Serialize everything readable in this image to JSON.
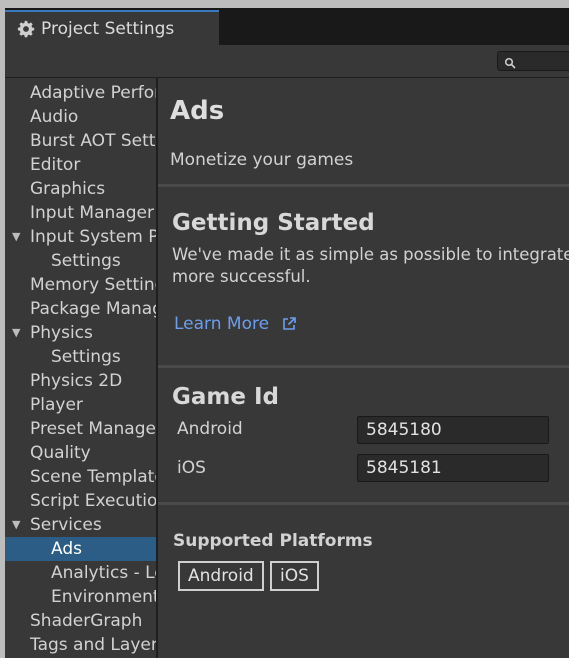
{
  "window": {
    "tab_title": "Project Settings"
  },
  "sidebar": {
    "items": [
      {
        "label": "Adaptive Performance",
        "level": 0
      },
      {
        "label": "Audio",
        "level": 0
      },
      {
        "label": "Burst AOT Settings",
        "level": 0
      },
      {
        "label": "Editor",
        "level": 0
      },
      {
        "label": "Graphics",
        "level": 0
      },
      {
        "label": "Input Manager",
        "level": 0
      },
      {
        "label": "Input System Package",
        "level": 0,
        "expanded": true
      },
      {
        "label": "Settings",
        "level": 1
      },
      {
        "label": "Memory Settings",
        "level": 0
      },
      {
        "label": "Package Manager",
        "level": 0
      },
      {
        "label": "Physics",
        "level": 0,
        "expanded": true
      },
      {
        "label": "Settings",
        "level": 1
      },
      {
        "label": "Physics 2D",
        "level": 0
      },
      {
        "label": "Player",
        "level": 0
      },
      {
        "label": "Preset Manager",
        "level": 0
      },
      {
        "label": "Quality",
        "level": 0
      },
      {
        "label": "Scene Template",
        "level": 0
      },
      {
        "label": "Script Execution Order",
        "level": 0
      },
      {
        "label": "Services",
        "level": 0,
        "expanded": true
      },
      {
        "label": "Ads",
        "level": 1,
        "selected": true
      },
      {
        "label": "Analytics - Legacy",
        "level": 1
      },
      {
        "label": "Environment",
        "level": 1
      },
      {
        "label": "ShaderGraph",
        "level": 0
      },
      {
        "label": "Tags and Layers",
        "level": 0
      }
    ]
  },
  "main": {
    "title": "Ads",
    "subtitle": "Monetize your games",
    "getting_started": {
      "heading": "Getting Started",
      "line1": "We've made it as simple as possible to integrate Ads into your game to make it",
      "line2": "more successful.",
      "link": "Learn More"
    },
    "game_id": {
      "heading": "Game Id",
      "android_label": "Android",
      "android_value": "5845180",
      "ios_label": "iOS",
      "ios_value": "5845181"
    },
    "platforms": {
      "heading": "Supported Platforms",
      "items": [
        "Android",
        "iOS"
      ]
    }
  },
  "colors": {
    "accent": "#2c5d87",
    "link": "#6d9eed",
    "tab_highlight": "#3a79bb"
  }
}
